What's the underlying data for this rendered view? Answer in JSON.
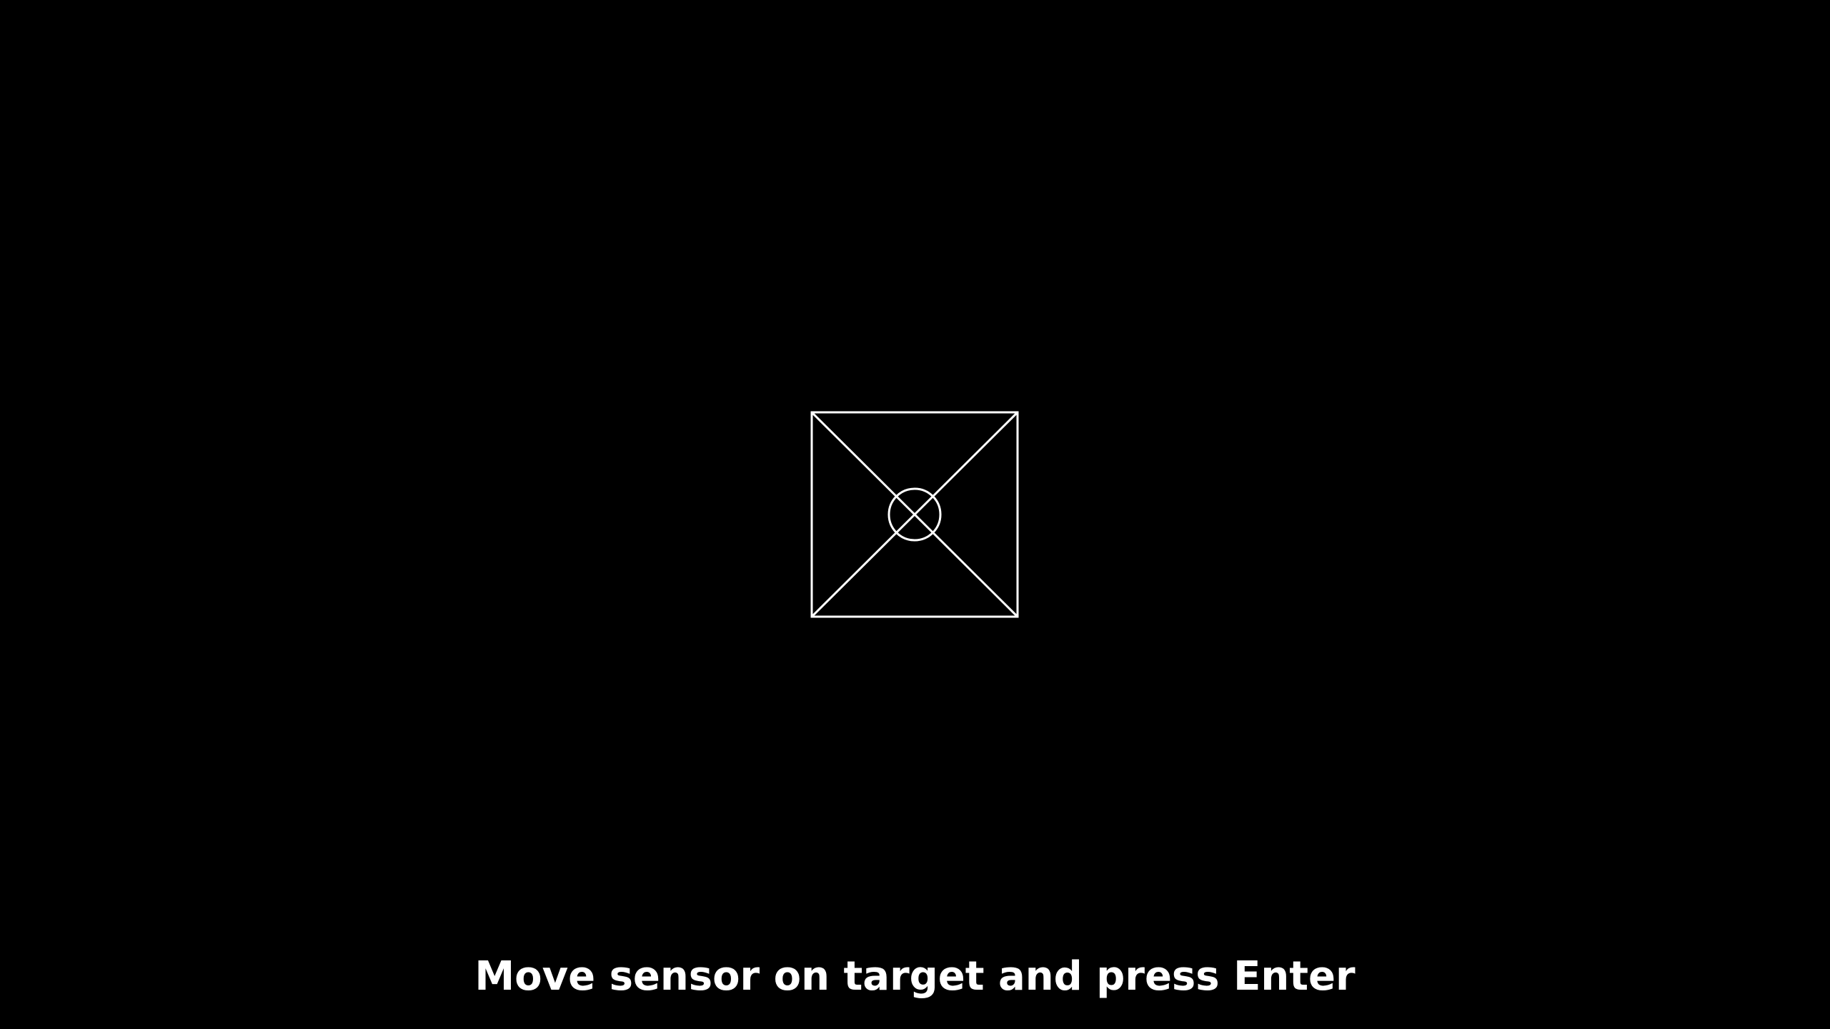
{
  "screen": {
    "instruction": "Move sensor on target and press Enter",
    "background_color": "#000000",
    "foreground_color": "#ffffff",
    "target_icon": "calibration-target-icon"
  }
}
